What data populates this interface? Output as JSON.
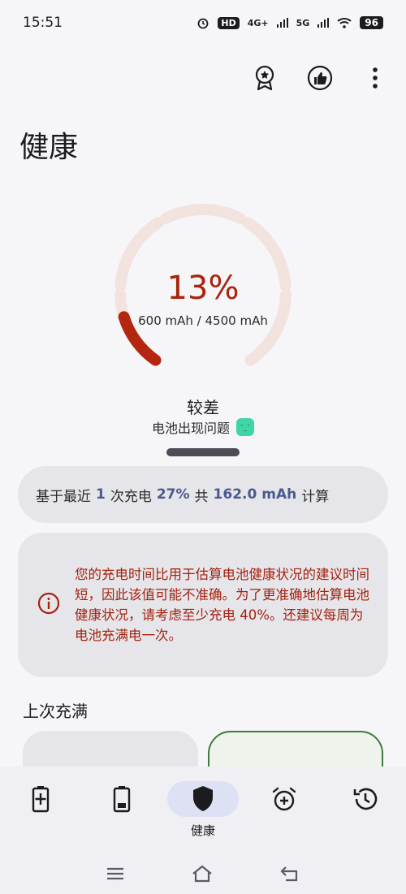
{
  "status_bar": {
    "time": "15:51",
    "hd_badge": "HD",
    "network_1": "4G+",
    "network_2": "5G",
    "battery": "96"
  },
  "page": {
    "title": "健康"
  },
  "gauge": {
    "percent_text": "13%",
    "percent_value": 13,
    "capacity_text": "600 mAh / 4500 mAh",
    "track_color": "#f2e3df",
    "fill_color": "#b3260f"
  },
  "health": {
    "status": "较差",
    "substatus": "电池出现问题"
  },
  "info_card": {
    "prefix": "基于最近",
    "count": "1",
    "middle": "次充电",
    "percent": "27%",
    "total_label": "共",
    "mah": "162.0 mAh",
    "suffix": "计算"
  },
  "warning_card": {
    "text": "您的充电时间比用于估算电池健康状况的建议时间短，因此该值可能不准确。为了更准确地估算电池健康状况，请考虑至少充电 40%。还建议每周为电池充满电一次。"
  },
  "section": {
    "last_full_charge": "上次充满"
  },
  "bottom_nav": {
    "active_label": "健康"
  },
  "colors": {
    "accent_red": "#a3230f",
    "number_blue": "#4a5a8c",
    "active_pill": "#dee1f3"
  }
}
